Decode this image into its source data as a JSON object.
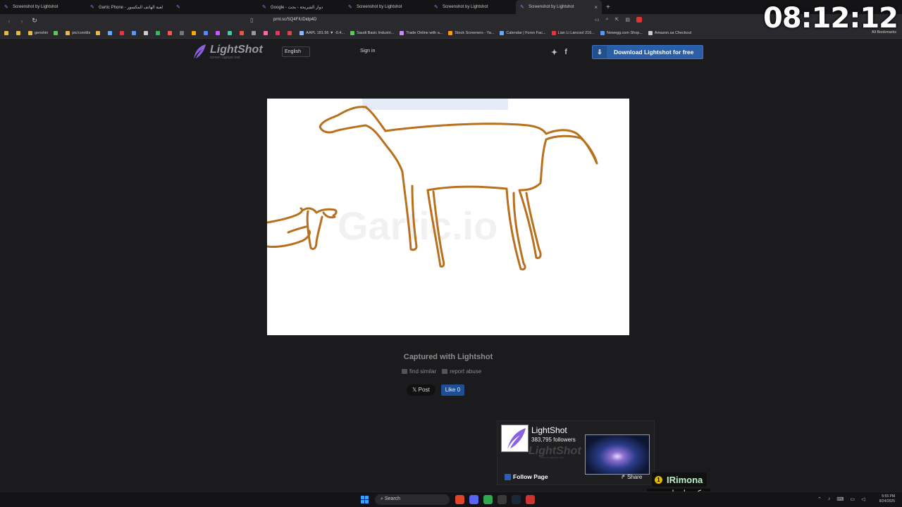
{
  "browser": {
    "tabs": [
      {
        "label": "Screenshot by Lightshot",
        "active": false
      },
      {
        "label": "Gartic Phone - لعبة الهاتف المكسور",
        "active": false
      },
      {
        "label": "",
        "active": false
      },
      {
        "label": "Google - دوار الشريحة - بحث",
        "active": false
      },
      {
        "label": "Screenshot by Lightshot",
        "active": false
      },
      {
        "label": "Screenshot by Lightshot",
        "active": false
      },
      {
        "label": "Screenshot by Lightshot",
        "active": true
      }
    ],
    "new_tab": "+",
    "url": "prnt.sc/SQ4FIUDidp4D",
    "bookmarks": [
      {
        "label": "",
        "icon": "folder"
      },
      {
        "label": "",
        "icon": "folder"
      },
      {
        "label": "genshin",
        "icon": "folder"
      },
      {
        "label": "",
        "icon": "site"
      },
      {
        "label": "pic/con/dis",
        "icon": "folder"
      },
      {
        "label": "",
        "icon": "folder"
      },
      {
        "label": "",
        "icon": "site"
      },
      {
        "label": "",
        "icon": "site"
      },
      {
        "label": "",
        "icon": "site"
      },
      {
        "label": "",
        "icon": "site"
      },
      {
        "label": "",
        "icon": "site"
      },
      {
        "label": "",
        "icon": "site"
      },
      {
        "label": "",
        "icon": "site"
      },
      {
        "label": "",
        "icon": "site"
      },
      {
        "label": "",
        "icon": "site"
      },
      {
        "label": "",
        "icon": "site"
      },
      {
        "label": "",
        "icon": "site"
      },
      {
        "label": "",
        "icon": "site"
      },
      {
        "label": "",
        "icon": "site"
      },
      {
        "label": "",
        "icon": "site"
      },
      {
        "label": "",
        "icon": "site"
      },
      {
        "label": "",
        "icon": "site"
      },
      {
        "label": "AAPL 181.56 ▼ -0.4...",
        "icon": "site"
      },
      {
        "label": "Saudi Basic Industri...",
        "icon": "site"
      },
      {
        "label": "Trade Online with a...",
        "icon": "site"
      },
      {
        "label": "Stock Screeners - Ya...",
        "icon": "site"
      },
      {
        "label": "Calendar | Forex Fac...",
        "icon": "site"
      },
      {
        "label": "Lian Li Lancool 216...",
        "icon": "site"
      },
      {
        "label": "Newegg.com Shop...",
        "icon": "site"
      },
      {
        "label": "Amazon.sa Checkout",
        "icon": "site"
      }
    ],
    "all_bookmarks": "All Bookmarks"
  },
  "overlay_clock": "08:12:12",
  "header": {
    "logo_title": "LightShot",
    "logo_subtitle": "screen capture tool",
    "language": "English",
    "signin": "Sign in",
    "download_label": "Download Lightshot for free"
  },
  "image": {
    "watermark": "Gartic.io"
  },
  "footer": {
    "captured": "Captured with Lightshot",
    "find_similar": "find similar",
    "report_abuse": "report abuse",
    "post": "𝕏 Post",
    "like": "Like 0"
  },
  "fb_widget": {
    "page_name": "LightShot",
    "followers": "383,795 followers",
    "cover_logo": "LightShot",
    "cover_sub": "screen capture tool",
    "follow": "Follow Page",
    "share": "Share"
  },
  "chat": {
    "badge": "1",
    "user": "IRimona",
    "message": "سكوب ارسل رسمه"
  },
  "taskbar": {
    "search": "Search",
    "time": "5:55 PM",
    "date": "8/24/2025"
  },
  "colors": {
    "accent": "#2a5fa8",
    "drawing_stroke": "#b8701d",
    "page_bg": "#1b1b1d"
  }
}
